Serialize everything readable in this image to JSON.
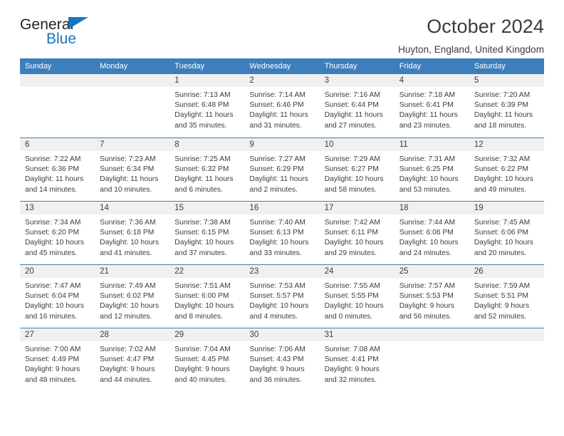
{
  "brand": {
    "name_part1": "General",
    "name_part2": "Blue",
    "accent_color": "#1c75bc"
  },
  "header": {
    "title": "October 2024",
    "subtitle": "Huyton, England, United Kingdom"
  },
  "calendar": {
    "header_color": "#3d7ebd",
    "weekdays": [
      "Sunday",
      "Monday",
      "Tuesday",
      "Wednesday",
      "Thursday",
      "Friday",
      "Saturday"
    ],
    "labels": {
      "sunrise": "Sunrise:",
      "sunset": "Sunset:",
      "daylight": "Daylight:"
    },
    "weeks": [
      [
        {
          "day": ""
        },
        {
          "day": ""
        },
        {
          "day": "1",
          "sunrise": "Sunrise: 7:13 AM",
          "sunset": "Sunset: 6:48 PM",
          "daylight_line1": "Daylight: 11 hours",
          "daylight_line2": "and 35 minutes."
        },
        {
          "day": "2",
          "sunrise": "Sunrise: 7:14 AM",
          "sunset": "Sunset: 6:46 PM",
          "daylight_line1": "Daylight: 11 hours",
          "daylight_line2": "and 31 minutes."
        },
        {
          "day": "3",
          "sunrise": "Sunrise: 7:16 AM",
          "sunset": "Sunset: 6:44 PM",
          "daylight_line1": "Daylight: 11 hours",
          "daylight_line2": "and 27 minutes."
        },
        {
          "day": "4",
          "sunrise": "Sunrise: 7:18 AM",
          "sunset": "Sunset: 6:41 PM",
          "daylight_line1": "Daylight: 11 hours",
          "daylight_line2": "and 23 minutes."
        },
        {
          "day": "5",
          "sunrise": "Sunrise: 7:20 AM",
          "sunset": "Sunset: 6:39 PM",
          "daylight_line1": "Daylight: 11 hours",
          "daylight_line2": "and 18 minutes."
        }
      ],
      [
        {
          "day": "6",
          "sunrise": "Sunrise: 7:22 AM",
          "sunset": "Sunset: 6:36 PM",
          "daylight_line1": "Daylight: 11 hours",
          "daylight_line2": "and 14 minutes."
        },
        {
          "day": "7",
          "sunrise": "Sunrise: 7:23 AM",
          "sunset": "Sunset: 6:34 PM",
          "daylight_line1": "Daylight: 11 hours",
          "daylight_line2": "and 10 minutes."
        },
        {
          "day": "8",
          "sunrise": "Sunrise: 7:25 AM",
          "sunset": "Sunset: 6:32 PM",
          "daylight_line1": "Daylight: 11 hours",
          "daylight_line2": "and 6 minutes."
        },
        {
          "day": "9",
          "sunrise": "Sunrise: 7:27 AM",
          "sunset": "Sunset: 6:29 PM",
          "daylight_line1": "Daylight: 11 hours",
          "daylight_line2": "and 2 minutes."
        },
        {
          "day": "10",
          "sunrise": "Sunrise: 7:29 AM",
          "sunset": "Sunset: 6:27 PM",
          "daylight_line1": "Daylight: 10 hours",
          "daylight_line2": "and 58 minutes."
        },
        {
          "day": "11",
          "sunrise": "Sunrise: 7:31 AM",
          "sunset": "Sunset: 6:25 PM",
          "daylight_line1": "Daylight: 10 hours",
          "daylight_line2": "and 53 minutes."
        },
        {
          "day": "12",
          "sunrise": "Sunrise: 7:32 AM",
          "sunset": "Sunset: 6:22 PM",
          "daylight_line1": "Daylight: 10 hours",
          "daylight_line2": "and 49 minutes."
        }
      ],
      [
        {
          "day": "13",
          "sunrise": "Sunrise: 7:34 AM",
          "sunset": "Sunset: 6:20 PM",
          "daylight_line1": "Daylight: 10 hours",
          "daylight_line2": "and 45 minutes."
        },
        {
          "day": "14",
          "sunrise": "Sunrise: 7:36 AM",
          "sunset": "Sunset: 6:18 PM",
          "daylight_line1": "Daylight: 10 hours",
          "daylight_line2": "and 41 minutes."
        },
        {
          "day": "15",
          "sunrise": "Sunrise: 7:38 AM",
          "sunset": "Sunset: 6:15 PM",
          "daylight_line1": "Daylight: 10 hours",
          "daylight_line2": "and 37 minutes."
        },
        {
          "day": "16",
          "sunrise": "Sunrise: 7:40 AM",
          "sunset": "Sunset: 6:13 PM",
          "daylight_line1": "Daylight: 10 hours",
          "daylight_line2": "and 33 minutes."
        },
        {
          "day": "17",
          "sunrise": "Sunrise: 7:42 AM",
          "sunset": "Sunset: 6:11 PM",
          "daylight_line1": "Daylight: 10 hours",
          "daylight_line2": "and 29 minutes."
        },
        {
          "day": "18",
          "sunrise": "Sunrise: 7:44 AM",
          "sunset": "Sunset: 6:08 PM",
          "daylight_line1": "Daylight: 10 hours",
          "daylight_line2": "and 24 minutes."
        },
        {
          "day": "19",
          "sunrise": "Sunrise: 7:45 AM",
          "sunset": "Sunset: 6:06 PM",
          "daylight_line1": "Daylight: 10 hours",
          "daylight_line2": "and 20 minutes."
        }
      ],
      [
        {
          "day": "20",
          "sunrise": "Sunrise: 7:47 AM",
          "sunset": "Sunset: 6:04 PM",
          "daylight_line1": "Daylight: 10 hours",
          "daylight_line2": "and 16 minutes."
        },
        {
          "day": "21",
          "sunrise": "Sunrise: 7:49 AM",
          "sunset": "Sunset: 6:02 PM",
          "daylight_line1": "Daylight: 10 hours",
          "daylight_line2": "and 12 minutes."
        },
        {
          "day": "22",
          "sunrise": "Sunrise: 7:51 AM",
          "sunset": "Sunset: 6:00 PM",
          "daylight_line1": "Daylight: 10 hours",
          "daylight_line2": "and 8 minutes."
        },
        {
          "day": "23",
          "sunrise": "Sunrise: 7:53 AM",
          "sunset": "Sunset: 5:57 PM",
          "daylight_line1": "Daylight: 10 hours",
          "daylight_line2": "and 4 minutes."
        },
        {
          "day": "24",
          "sunrise": "Sunrise: 7:55 AM",
          "sunset": "Sunset: 5:55 PM",
          "daylight_line1": "Daylight: 10 hours",
          "daylight_line2": "and 0 minutes."
        },
        {
          "day": "25",
          "sunrise": "Sunrise: 7:57 AM",
          "sunset": "Sunset: 5:53 PM",
          "daylight_line1": "Daylight: 9 hours",
          "daylight_line2": "and 56 minutes."
        },
        {
          "day": "26",
          "sunrise": "Sunrise: 7:59 AM",
          "sunset": "Sunset: 5:51 PM",
          "daylight_line1": "Daylight: 9 hours",
          "daylight_line2": "and 52 minutes."
        }
      ],
      [
        {
          "day": "27",
          "sunrise": "Sunrise: 7:00 AM",
          "sunset": "Sunset: 4:49 PM",
          "daylight_line1": "Daylight: 9 hours",
          "daylight_line2": "and 48 minutes."
        },
        {
          "day": "28",
          "sunrise": "Sunrise: 7:02 AM",
          "sunset": "Sunset: 4:47 PM",
          "daylight_line1": "Daylight: 9 hours",
          "daylight_line2": "and 44 minutes."
        },
        {
          "day": "29",
          "sunrise": "Sunrise: 7:04 AM",
          "sunset": "Sunset: 4:45 PM",
          "daylight_line1": "Daylight: 9 hours",
          "daylight_line2": "and 40 minutes."
        },
        {
          "day": "30",
          "sunrise": "Sunrise: 7:06 AM",
          "sunset": "Sunset: 4:43 PM",
          "daylight_line1": "Daylight: 9 hours",
          "daylight_line2": "and 36 minutes."
        },
        {
          "day": "31",
          "sunrise": "Sunrise: 7:08 AM",
          "sunset": "Sunset: 4:41 PM",
          "daylight_line1": "Daylight: 9 hours",
          "daylight_line2": "and 32 minutes."
        },
        {
          "day": ""
        },
        {
          "day": ""
        }
      ]
    ]
  }
}
